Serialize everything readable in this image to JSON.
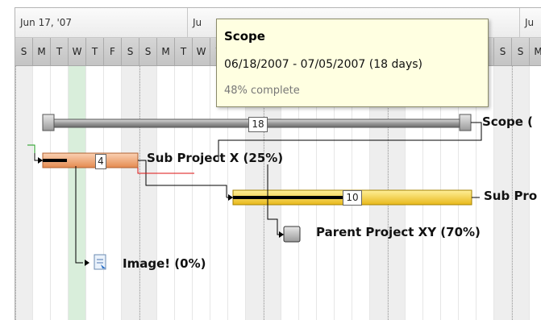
{
  "header": {
    "weeks": [
      "Jun 17, '07",
      "Ju",
      "Ju"
    ],
    "days": [
      "S",
      "M",
      "T",
      "W",
      "T",
      "F",
      "S",
      "S",
      "M",
      "T",
      "W",
      "T",
      "F",
      "S",
      "S",
      "M",
      "T",
      "W",
      "T",
      "F",
      "S",
      "S",
      "M",
      "T",
      "W",
      "T",
      "F",
      "S",
      "S",
      "M"
    ]
  },
  "tasks": {
    "scope": {
      "label": "Scope (",
      "duration": "18",
      "percent_complete": 48
    },
    "sub_x": {
      "label": "Sub Project X (25%)",
      "duration": "4",
      "percent_complete": 25,
      "color": "#f0a070"
    },
    "sub_y": {
      "label": "Sub Pro",
      "duration": "10",
      "color": "#f7d33b"
    },
    "parent_xy": {
      "label": "Parent Project XY (70%)",
      "percent_complete": 70
    },
    "image": {
      "label": "Image! (0%)",
      "percent_complete": 0,
      "icon": "document-icon"
    }
  },
  "tooltip": {
    "title": "Scope",
    "range": "06/18/2007 - 07/05/2007 (18 days)",
    "complete": "48% complete"
  }
}
